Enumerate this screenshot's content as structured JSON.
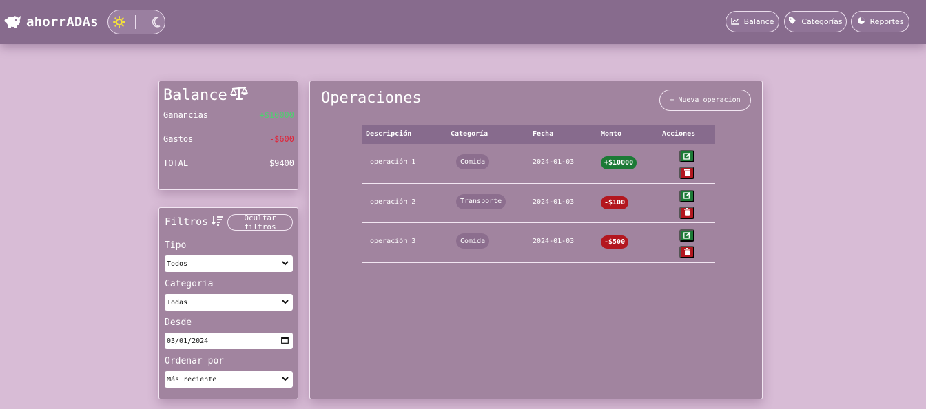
{
  "navbar": {
    "brand": "ahorrADAs",
    "nav": [
      {
        "label": "Balance",
        "icon": "chart-line-icon"
      },
      {
        "label": "Categorías",
        "icon": "tag-icon"
      },
      {
        "label": "Reportes",
        "icon": "pie-chart-icon"
      }
    ]
  },
  "balance": {
    "title": "Balance",
    "rows": [
      {
        "label": "Ganancias",
        "value": "+$10000"
      },
      {
        "label": "Gastos",
        "value": "-$600"
      },
      {
        "label": "TOTAL",
        "value": "$9400"
      }
    ]
  },
  "filters": {
    "title": "Filtros",
    "hide_label": "Ocultar filtros",
    "fields": [
      {
        "label": "Tipo",
        "value": "Todos",
        "kind": "select"
      },
      {
        "label": "Categoria",
        "value": "Todas",
        "kind": "select"
      },
      {
        "label": "Desde",
        "value": "03/01/2024",
        "kind": "date"
      },
      {
        "label": "Ordenar por",
        "value": "Más reciente",
        "kind": "select"
      }
    ]
  },
  "operations": {
    "title": "Operaciones",
    "new_label": "+ Nueva operacion",
    "columns": [
      "Descripción",
      "Categoría",
      "Fecha",
      "Monto",
      "Acciones"
    ],
    "rows": [
      {
        "description": "operación 1",
        "category": "Comida",
        "date": "2024-01-03",
        "amount": "+$10000",
        "sign": "positive"
      },
      {
        "description": "operación 2",
        "category": "Transporte",
        "date": "2024-01-03",
        "amount": "-$100",
        "sign": "negative"
      },
      {
        "description": "operación 3",
        "category": "Comida",
        "date": "2024-01-03",
        "amount": "-$500",
        "sign": "negative"
      }
    ]
  },
  "colors": {
    "page_bg": "#d8bcd6",
    "navbar_bg": "#876b8d",
    "card_bg": "#a1849f",
    "positive": "#1c7a36",
    "negative": "#b3171f",
    "positive_text": "#4bd36e",
    "negative_text": "#e0253a"
  }
}
